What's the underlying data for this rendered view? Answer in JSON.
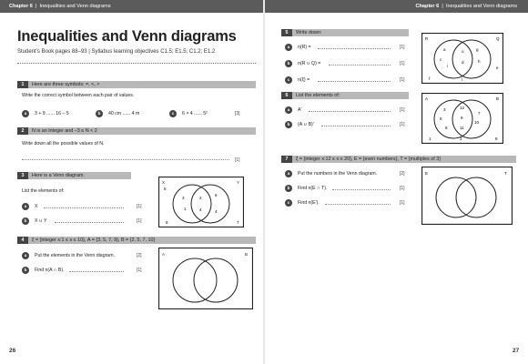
{
  "header": {
    "left": {
      "chapter": "Chapter 6",
      "title": "Inequalities and Venn diagrams"
    },
    "right": {
      "chapter": "Chapter 6",
      "title": "Inequalities and Venn diagrams"
    }
  },
  "main_title": "Inequalities and Venn diagrams",
  "subtitle": "Student’s Book pages 88–93  |  Syllabus learning objectives C1.5; E1.5; C1.2; E1.2",
  "left_page": {
    "page_number": "26",
    "q1": {
      "num": "1",
      "text": "Here are three symbols: =, <, >",
      "instruction": "Write the correct symbol between each pair of values.",
      "parts": [
        {
          "label": "a",
          "text": "3 + 9 ...... 16 – 5"
        },
        {
          "label": "b",
          "text": "40 cm ...... 4 m"
        },
        {
          "label": "c",
          "text": "6 × 4 ...... 5²"
        }
      ],
      "marks": "[3]"
    },
    "q2": {
      "num": "2",
      "text": "N is an integer and –3 ≤ N < 2",
      "instruction": "Write down all the possible values of N.",
      "marks": "[1]"
    },
    "q3": {
      "num": "3",
      "text": "Here is a Venn diagram.",
      "instruction": "List the elements of:",
      "parts": [
        {
          "label": "a",
          "text": "X",
          "marks": "[1]"
        },
        {
          "label": "b",
          "text": "X ∪ Y",
          "marks": "[1]"
        }
      ],
      "venn": {
        "universe": "ξ",
        "setA": "X",
        "setB": "Y",
        "left": [
          "3",
          "1"
        ],
        "middle": [
          "2",
          "4"
        ],
        "right": [
          "6",
          "4"
        ],
        "outside": [
          "5",
          "8",
          "7"
        ]
      }
    },
    "q4": {
      "num": "4",
      "text": "ξ = {integer x:1 ≤ x ≤ 10}, A = {3, 5, 7, 9}, B = {2, 5, 7, 10}",
      "parts": [
        {
          "label": "a",
          "text": "Put the elements in the Venn diagram.",
          "marks": "[2]"
        },
        {
          "label": "b",
          "text": "Find n(A ∩ B).",
          "marks": "[1]"
        }
      ],
      "venn": {
        "universe": "ξ",
        "setA": "A",
        "setB": "B"
      }
    }
  },
  "right_page": {
    "page_number": "27",
    "q5": {
      "num": "5",
      "text": "Write down:",
      "parts": [
        {
          "label": "a",
          "text": "n(R) =",
          "marks": "[1]"
        },
        {
          "label": "b",
          "text": "n(R ∪ Q) =",
          "marks": "[1]"
        },
        {
          "label": "c",
          "text": "n(ξ) =",
          "marks": "[1]"
        }
      ],
      "venn": {
        "universe": "ξ",
        "setA": "R",
        "setB": "Q",
        "left": [
          "a",
          "c",
          "i"
        ],
        "middle": [
          "o",
          "d"
        ],
        "right": [
          "g",
          "h"
        ],
        "outside": [
          "e",
          "f",
          "l"
        ]
      }
    },
    "q6": {
      "num": "6",
      "text": "List the elements of:",
      "parts": [
        {
          "label": "a",
          "text": "A′",
          "marks": "[1]"
        },
        {
          "label": "b",
          "text": "(A ∪ B)′",
          "marks": "[1]"
        }
      ],
      "venn": {
        "universe": "ξ",
        "setA": "A",
        "setB": "B",
        "left": [
          "3",
          "5",
          "6"
        ],
        "middle": [
          "12",
          "9",
          "11"
        ],
        "right": [
          "7",
          "10"
        ],
        "outside": [
          "1",
          "2",
          "8"
        ]
      }
    },
    "q7": {
      "num": "7",
      "text": "ξ = {integer x:12 ≤ x ≤ 20}, E = {even numbers}, T = {multiples of 3}",
      "parts": [
        {
          "label": "a",
          "text": "Put the numbers in the Venn diagram.",
          "marks": "[2]"
        },
        {
          "label": "b",
          "text": "Find n(E ∩ T).",
          "marks": "[1]"
        },
        {
          "label": "c",
          "text": "Find n(E′).",
          "marks": "[1]"
        }
      ],
      "venn": {
        "universe": "ξ",
        "setA": "E",
        "setB": "T"
      }
    }
  }
}
